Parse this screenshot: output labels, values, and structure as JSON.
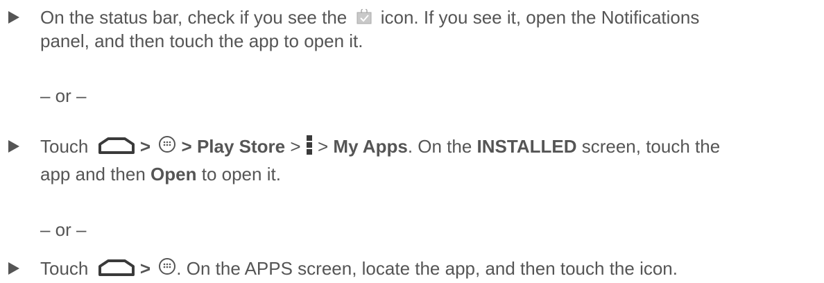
{
  "step1": {
    "line1_a": "On the status bar, check if you see the",
    "icon": "store-bag-check-icon",
    "line1_b": "icon. If you see it, open the Notifications",
    "line2": "panel, and then touch the app to open it."
  },
  "or1": "– or –",
  "step2": {
    "touch": "Touch",
    "home_icon": "home-icon",
    "gt1": ">",
    "apps_icon": "apps-launcher-icon",
    "gt2": ">",
    "play_store": "Play Store",
    "gt3": ">",
    "menu_icon": "menu-icon",
    "gt4": ">",
    "my_apps": "My Apps",
    "line1_rest_a": ". On the ",
    "installed": "INSTALLED",
    "line1_rest_b": " screen, touch the",
    "line2_a": "app and then ",
    "open": "Open",
    "line2_b": " to open it."
  },
  "or2": "– or –",
  "step3": {
    "touch": "Touch",
    "home_icon": "home-icon",
    "gt1": ">",
    "apps_icon": "apps-launcher-icon",
    "rest": ". On the APPS screen, locate the app, and then touch the icon."
  },
  "colors": {
    "text": "#555555",
    "icon_dark": "#3a3a3a"
  }
}
